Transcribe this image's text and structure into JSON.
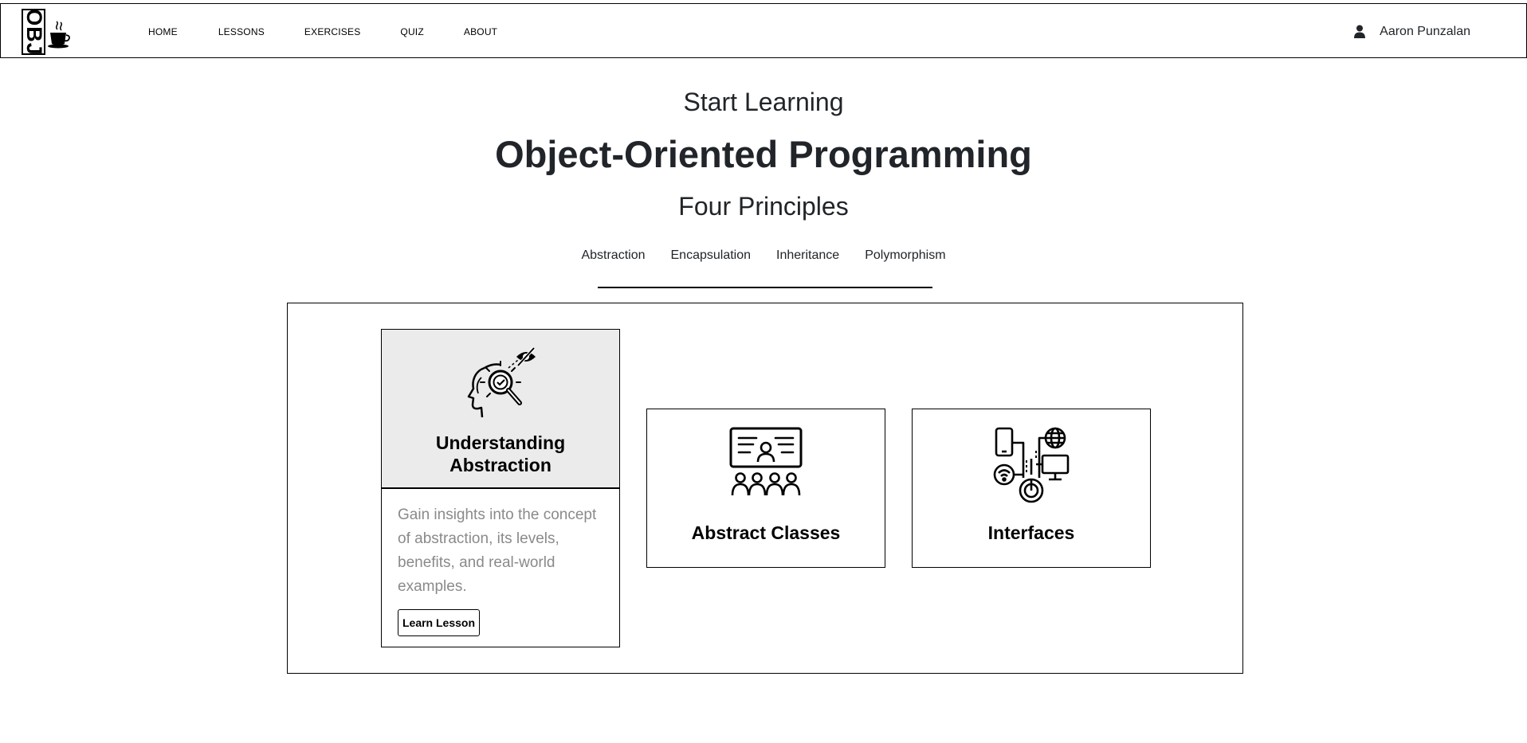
{
  "header": {
    "logo_text": "OBJ",
    "nav": [
      {
        "label": "HOME"
      },
      {
        "label": "LESSONS"
      },
      {
        "label": "EXERCISES"
      },
      {
        "label": "QUIZ"
      },
      {
        "label": "ABOUT"
      }
    ],
    "user": {
      "name": "Aaron Punzalan",
      "icon": "user-icon"
    }
  },
  "hero": {
    "kicker": "Start Learning",
    "title": "Object-Oriented Programming",
    "subtitle": "Four Principles"
  },
  "principles": {
    "tabs": [
      {
        "label": "Abstraction"
      },
      {
        "label": "Encapsulation"
      },
      {
        "label": "Inheritance"
      },
      {
        "label": "Polymorphism"
      }
    ]
  },
  "cards": [
    {
      "title_line1": "Understanding",
      "title_line2": "Abstraction",
      "icon": "head-magnifier-hidden-eye-icon",
      "description": "Gain insights into the concept of abstraction, its levels, benefits, and real-world examples.",
      "button": "Learn Lesson",
      "highlight_color": "#ebebeb"
    },
    {
      "title": "Abstract Classes",
      "icon": "classroom-presentation-icon"
    },
    {
      "title": "Interfaces",
      "icon": "connected-devices-icon"
    }
  ]
}
